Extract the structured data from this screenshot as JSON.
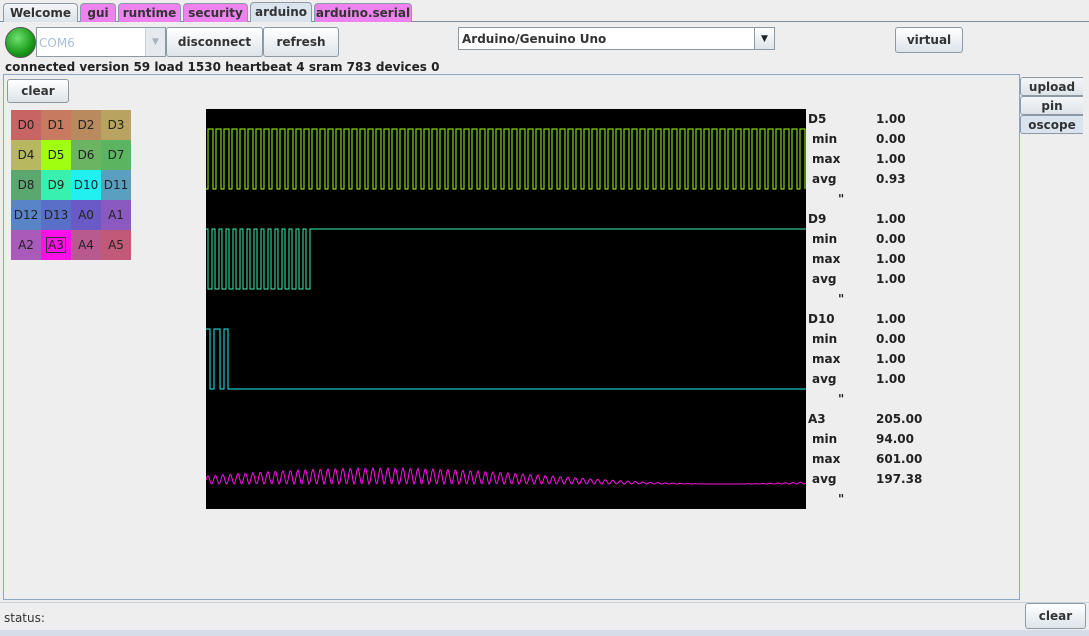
{
  "tabs": [
    {
      "label": "Welcome",
      "style": "plain"
    },
    {
      "label": "gui",
      "style": "pink"
    },
    {
      "label": "runtime",
      "style": "pink"
    },
    {
      "label": "security",
      "style": "pink"
    },
    {
      "label": "arduino",
      "style": "active"
    },
    {
      "label": "arduino.serial",
      "style": "pink"
    }
  ],
  "toolbar": {
    "port_value": "COM6",
    "disconnect_label": "disconnect",
    "refresh_label": "refresh",
    "board_value": "Arduino/Genuino Uno",
    "virtual_label": "virtual",
    "connection_status": "connected version 59 load 1530 heartbeat 4 sram 783 devices 0",
    "led_color": "#22aa22"
  },
  "panel": {
    "clear_label": "clear"
  },
  "pins": [
    {
      "label": "D0",
      "color": "#c86464"
    },
    {
      "label": "D1",
      "color": "#c87a60"
    },
    {
      "label": "D2",
      "color": "#b88a5e"
    },
    {
      "label": "D3",
      "color": "#b8a460"
    },
    {
      "label": "D4",
      "color": "#b8b860"
    },
    {
      "label": "D5",
      "color": "#a0ff10"
    },
    {
      "label": "D6",
      "color": "#6ab462"
    },
    {
      "label": "D7",
      "color": "#5ab460"
    },
    {
      "label": "D8",
      "color": "#5aa870"
    },
    {
      "label": "D9",
      "color": "#38f0b0"
    },
    {
      "label": "D10",
      "color": "#20f0f0"
    },
    {
      "label": "D11",
      "color": "#5a9ec0"
    },
    {
      "label": "D12",
      "color": "#5a84c8"
    },
    {
      "label": "D13",
      "color": "#5a70c8"
    },
    {
      "label": "A0",
      "color": "#6a5ac8"
    },
    {
      "label": "A1",
      "color": "#8a5ac0"
    },
    {
      "label": "A2",
      "color": "#aa5ab8"
    },
    {
      "label": "A3",
      "color": "#ff10e8",
      "selected": true
    },
    {
      "label": "A4",
      "color": "#b85a90"
    },
    {
      "label": "A5",
      "color": "#c05a78"
    }
  ],
  "traces": [
    {
      "name": "D5",
      "value": "1.00",
      "min": "0.00",
      "max": "1.00",
      "avg": "0.93",
      "color": "#a0ff10"
    },
    {
      "name": "D9",
      "value": "1.00",
      "min": "0.00",
      "max": "1.00",
      "avg": "1.00",
      "color": "#38f0b0"
    },
    {
      "name": "D10",
      "value": "1.00",
      "min": "0.00",
      "max": "1.00",
      "avg": "1.00",
      "color": "#20f0f0"
    },
    {
      "name": "A3",
      "value": "205.00",
      "min": "94.00",
      "max": "601.00",
      "avg": "197.38",
      "color": "#ff10e8"
    }
  ],
  "stat_labels": {
    "min": "min",
    "max": "max",
    "avg": "avg",
    "mark": "\""
  },
  "side_tabs": [
    {
      "label": "upload",
      "active": false
    },
    {
      "label": "pin",
      "active": false
    },
    {
      "label": "oscope",
      "active": true
    }
  ],
  "statusbar": {
    "label": "status:",
    "clear_label": "clear"
  }
}
